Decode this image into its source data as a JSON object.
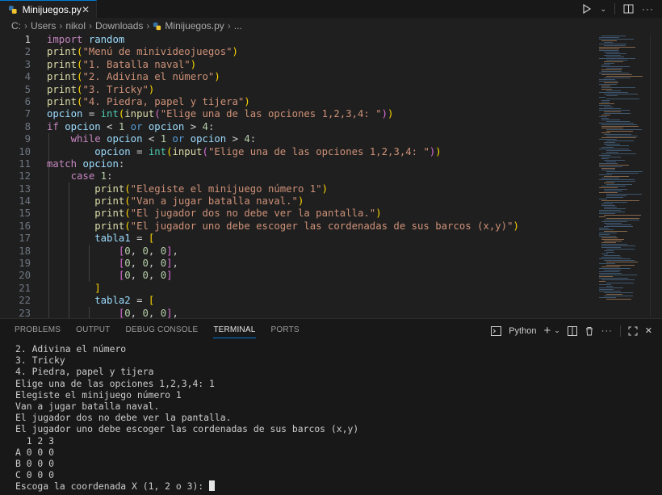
{
  "tab": {
    "filename": "Minijuegos.py"
  },
  "breadcrumb": {
    "items": [
      "C:",
      "Users",
      "nikol",
      "Downloads",
      "Minijuegos.py",
      "..."
    ]
  },
  "editor": {
    "line_numbers": [
      "1",
      "2",
      "3",
      "4",
      "5",
      "6",
      "7",
      "8",
      "9",
      "10",
      "11",
      "12",
      "13",
      "14",
      "15",
      "16",
      "17",
      "18",
      "19",
      "20",
      "21",
      "22",
      "23"
    ],
    "active_line": 1
  },
  "panel": {
    "tabs": [
      "PROBLEMS",
      "OUTPUT",
      "DEBUG CONSOLE",
      "TERMINAL",
      "PORTS"
    ],
    "active_tab": "TERMINAL",
    "shell": "Python"
  },
  "terminal": {
    "lines": [
      "2. Adivina el número",
      "3. Tricky",
      "4. Piedra, papel y tijera",
      "Elige una de las opciones 1,2,3,4: 1",
      "Elegiste el minijuego número 1",
      "Van a jugar batalla naval.",
      "El jugador dos no debe ver la pantalla.",
      "El jugador uno debe escoger las cordenadas de sus barcos (x,y)",
      "  1 2 3",
      "A 0 0 0",
      "B 0 0 0",
      "C 0 0 0"
    ],
    "prompt": "Escoga la coordenada X (1, 2 o 3): "
  },
  "colors": {
    "accent": "#0078d4",
    "keyword": "#c586c0",
    "function": "#dcdcaa",
    "string": "#ce9178",
    "number": "#b5cea8",
    "variable": "#9cdcfe"
  },
  "icons": [
    "python-file-icon",
    "run-icon",
    "split-editor-icon",
    "more-icon",
    "close-icon",
    "add-terminal-icon",
    "trash-icon",
    "maximize-icon"
  ]
}
